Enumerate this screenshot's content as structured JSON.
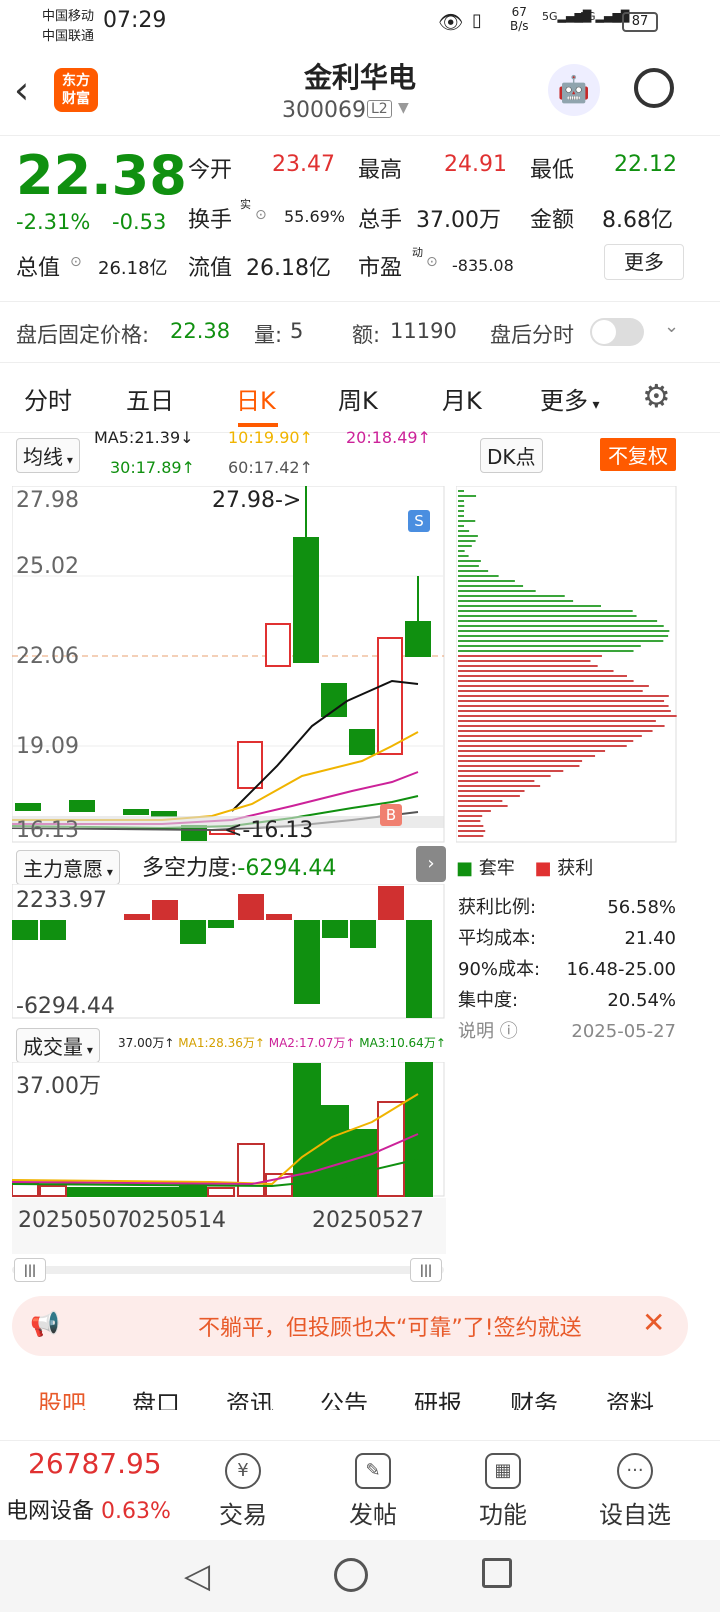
{
  "status": {
    "carrier1": "中国移动",
    "carrier2": "中国联通",
    "time": "07:29",
    "speed_top": "67",
    "speed_bottom": "B/s",
    "sig1": "5G",
    "sig2": "5G",
    "battery": "87"
  },
  "header": {
    "name": "金利华电",
    "code": "300069",
    "level": "L2",
    "logo_line1": "东方",
    "logo_line2": "财富"
  },
  "quote": {
    "price": "22.38",
    "change_pct": "-2.31%",
    "change": "-0.53",
    "open_label": "今开",
    "open": "23.47",
    "high_label": "最高",
    "high": "24.91",
    "low_label": "最低",
    "low": "22.12",
    "turnover_label": "换手",
    "turnover_sup": "实",
    "turnover": "55.69%",
    "volume_label": "总手",
    "volume": "37.00万",
    "amount_label": "金额",
    "amount": "8.68亿",
    "mcap_label": "总值",
    "mcap": "26.18亿",
    "float_label": "流值",
    "float": "26.18亿",
    "pe_label": "市盈",
    "pe_sup": "动",
    "pe": "-835.08",
    "more": "更多"
  },
  "after_hours": {
    "price_label": "盘后固定价格:",
    "price": "22.38",
    "qty_label": "量:",
    "qty": "5",
    "amt_label": "额:",
    "amt": "11190",
    "timeshare_label": "盘后分时"
  },
  "tabs": {
    "t1": "分时",
    "t2": "五日",
    "t3": "日K",
    "t4": "周K",
    "t5": "月K",
    "t6": "更多"
  },
  "kline": {
    "indicator": "均线",
    "ma5": "MA5:21.39↓",
    "ma10": "10:19.90↑",
    "ma20": "20:18.49↑",
    "ma30": "30:17.89↑",
    "ma60": "60:17.42↑",
    "dk": "DK点",
    "fq": "不复权",
    "y_top": "27.98",
    "y_2": "25.02",
    "y_3": "22.06",
    "y_4": "19.09",
    "y_bot": "16.13",
    "max_mark": "27.98->",
    "min_mark": "<-16.13",
    "s_badge": "S",
    "b_badge": "B"
  },
  "force": {
    "label": "主力意愿",
    "title": "多空力度:",
    "value": "-6294.44",
    "top": "2233.97",
    "bottom": "-6294.44"
  },
  "vol": {
    "label": "成交量",
    "v": "37.00万↑",
    "ma1": "MA1:28.36万↑",
    "ma2": "MA2:17.07万↑",
    "ma3": "MA3:10.64万↑",
    "top": "37.00万",
    "date1": "20250507",
    "date2": "0250514",
    "date3": "20250527"
  },
  "chips": {
    "legend_loss": "套牢",
    "legend_profit": "获利",
    "profit_ratio_label": "获利比例:",
    "profit_ratio": "56.58%",
    "avg_cost_label": "平均成本:",
    "avg_cost": "21.40",
    "cost90_label": "90%成本:",
    "cost90": "16.48-25.00",
    "conc_label": "集中度:",
    "conc": "20.54%",
    "note_label": "说明",
    "date": "2025-05-27"
  },
  "banner": {
    "text": "不躺平，但投顾也太“可靠”了!签约就送"
  },
  "subtabs": {
    "a": "股吧",
    "b": "盘口",
    "c": "资讯",
    "d": "公告",
    "e": "研报",
    "f": "财务",
    "g": "资料"
  },
  "bottom": {
    "index_value": "26787.95",
    "index_name": "电网设备",
    "index_pct": "0.63%",
    "trade": "交易",
    "post": "发帖",
    "func": "功能",
    "watch": "设自选"
  },
  "colors": {
    "up": "#e03131",
    "down": "#109010",
    "ma5": "#111111",
    "ma10": "#f0b400",
    "ma20": "#cc2299",
    "ma30": "#109010",
    "ma60": "#555555",
    "accent": "#ff6a00"
  }
}
